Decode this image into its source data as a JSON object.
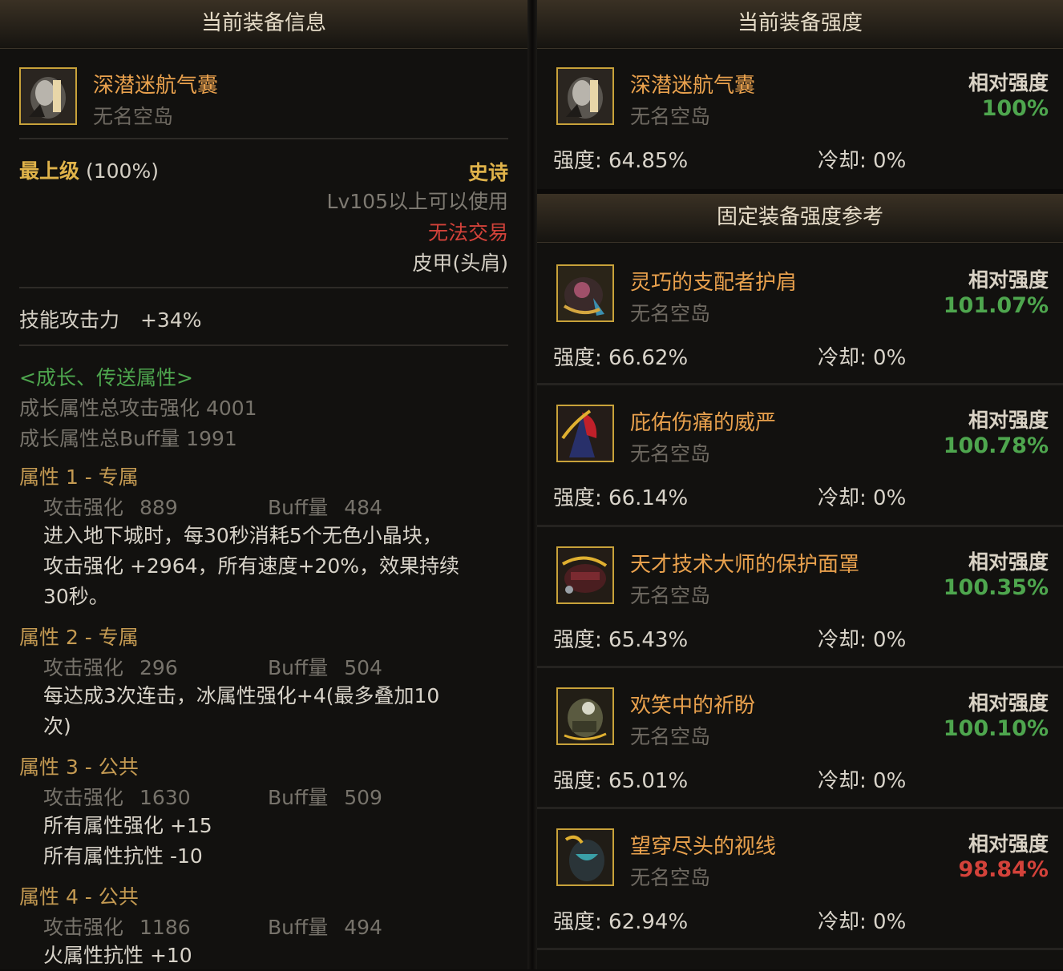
{
  "left": {
    "header": "当前装备信息",
    "item": {
      "name": "深潜迷航气囊",
      "owner": "无名空岛",
      "icon": "helmet-icon"
    },
    "grade_label": "最上级",
    "grade_value": "(100%)",
    "rarity": "史诗",
    "level_req": "Lv105以上可以使用",
    "trade": "无法交易",
    "type": "皮甲(头肩)",
    "skill_attack_label": "技能攻击力",
    "skill_attack_value": "+34%",
    "growth_header": "<成长、传送属性>",
    "growth_total_attack": "成长属性总攻击强化 4001",
    "growth_total_buff": "成长属性总Buff量 1991",
    "attrs": [
      {
        "title": "属性 1 - 专属",
        "atk_label": "攻击强化",
        "atk": "889",
        "buff_label": "Buff量",
        "buff": "484",
        "lines": [
          "进入地下城时，每30秒消耗5个无色小晶块，",
          "攻击强化 +2964，所有速度+20%，效果持续",
          "30秒。"
        ]
      },
      {
        "title": "属性 2 - 专属",
        "atk_label": "攻击强化",
        "atk": "296",
        "buff_label": "Buff量",
        "buff": "504",
        "lines": [
          "每达成3次连击，冰属性强化+4(最多叠加10",
          "次)"
        ]
      },
      {
        "title": "属性 3 - 公共",
        "atk_label": "攻击强化",
        "atk": "1630",
        "buff_label": "Buff量",
        "buff": "509",
        "lines": [
          "所有属性强化 +15",
          "所有属性抗性 -10"
        ]
      },
      {
        "title": "属性 4 - 公共",
        "atk_label": "攻击强化",
        "atk": "1186",
        "buff_label": "Buff量",
        "buff": "494",
        "lines": [
          "火属性抗性 +10"
        ]
      }
    ]
  },
  "right": {
    "header": "当前装备强度",
    "ref_header": "固定装备强度参考",
    "rel_label": "相对强度",
    "strength_label": "强度: ",
    "cooldown_label": "冷却: ",
    "current": {
      "name": "深潜迷航气囊",
      "owner": "无名空岛",
      "rel": "100%",
      "rel_color": "#4ea64e",
      "strength": "64.85%",
      "cooldown": "0%",
      "icon": "helmet-icon"
    },
    "refs": [
      {
        "name": "灵巧的支配者护肩",
        "owner": "无名空岛",
        "rel": "101.07%",
        "rel_color": "#4ea64e",
        "strength": "66.62%",
        "cooldown": "0%",
        "icon": "shoulder-armor-icon"
      },
      {
        "name": "庇佑伤痛的威严",
        "owner": "无名空岛",
        "rel": "100.78%",
        "rel_color": "#4ea64e",
        "strength": "66.14%",
        "cooldown": "0%",
        "icon": "feather-cape-icon"
      },
      {
        "name": "天才技术大师的保护面罩",
        "owner": "无名空岛",
        "rel": "100.35%",
        "rel_color": "#4ea64e",
        "strength": "65.43%",
        "cooldown": "0%",
        "icon": "mask-icon"
      },
      {
        "name": "欢笑中的祈盼",
        "owner": "无名空岛",
        "rel": "100.10%",
        "rel_color": "#4ea64e",
        "strength": "65.01%",
        "cooldown": "0%",
        "icon": "mech-helmet-icon"
      },
      {
        "name": "望穿尽头的视线",
        "owner": "无名空岛",
        "rel": "98.84%",
        "rel_color": "#d3423a",
        "strength": "62.94%",
        "cooldown": "0%",
        "icon": "dark-helm-icon"
      }
    ]
  }
}
